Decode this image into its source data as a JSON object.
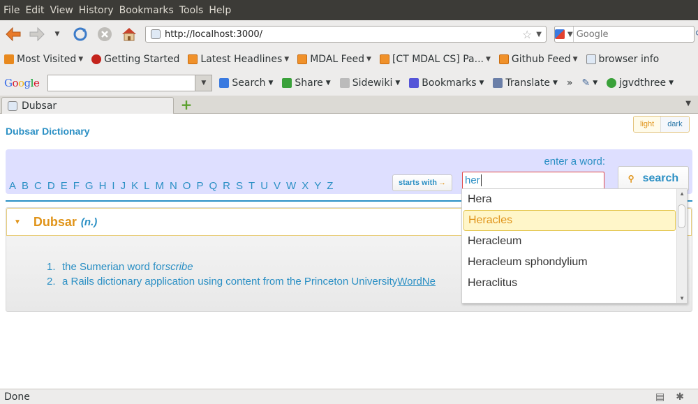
{
  "menu": [
    "File",
    "Edit",
    "View",
    "History",
    "Bookmarks",
    "Tools",
    "Help"
  ],
  "nav": {
    "url": "http://localhost:3000/",
    "search_placeholder": "Google"
  },
  "bookmarks": [
    {
      "label": "Most Visited",
      "icon": "orange",
      "arrow": true
    },
    {
      "label": "Getting Started",
      "icon": "red",
      "arrow": false
    },
    {
      "label": "Latest Headlines",
      "icon": "feed",
      "arrow": true
    },
    {
      "label": "MDAL Feed",
      "icon": "feed",
      "arrow": true
    },
    {
      "label": "[CT MDAL CS] Pa...",
      "icon": "feed",
      "arrow": true
    },
    {
      "label": "Github Feed",
      "icon": "feed",
      "arrow": true
    },
    {
      "label": "browser info",
      "icon": "page",
      "arrow": false
    }
  ],
  "google_toolbar": {
    "logo_letters": [
      "G",
      "o",
      "o",
      "g",
      "l",
      "e"
    ],
    "buttons": [
      {
        "label": "Search",
        "arrow": true
      },
      {
        "label": "Share",
        "arrow": true
      },
      {
        "label": "Sidewiki",
        "arrow": true
      },
      {
        "label": "Bookmarks",
        "arrow": true
      },
      {
        "label": "Translate",
        "arrow": true
      }
    ],
    "more": "»",
    "user": "jgvdthree"
  },
  "tab": {
    "title": "Dubsar"
  },
  "page": {
    "brand": "Dubsar Dictionary",
    "theme_light": "light",
    "theme_dark": "dark",
    "enter_label": "enter a word:",
    "letters": [
      "A",
      "B",
      "C",
      "D",
      "E",
      "F",
      "G",
      "H",
      "I",
      "J",
      "K",
      "L",
      "M",
      "N",
      "O",
      "P",
      "Q",
      "R",
      "S",
      "T",
      "U",
      "V",
      "W",
      "X",
      "Y",
      "Z"
    ],
    "starts_with": "starts with",
    "input_value": "her",
    "search_label": "search",
    "entry": {
      "word": "Dubsar",
      "pos": "(n.)",
      "definitions": [
        {
          "num": "1.",
          "text": "the Sumerian word for ",
          "em": "scribe"
        },
        {
          "num": "2.",
          "text": "a Rails dictionary application using content from the Princeton University ",
          "link": "WordNe"
        }
      ]
    },
    "autocomplete": [
      "Hera",
      "Heracles",
      "Heracleum",
      "Heracleum sphondylium",
      "Heraclitus"
    ],
    "autocomplete_selected": 1
  },
  "status": {
    "text": "Done"
  }
}
